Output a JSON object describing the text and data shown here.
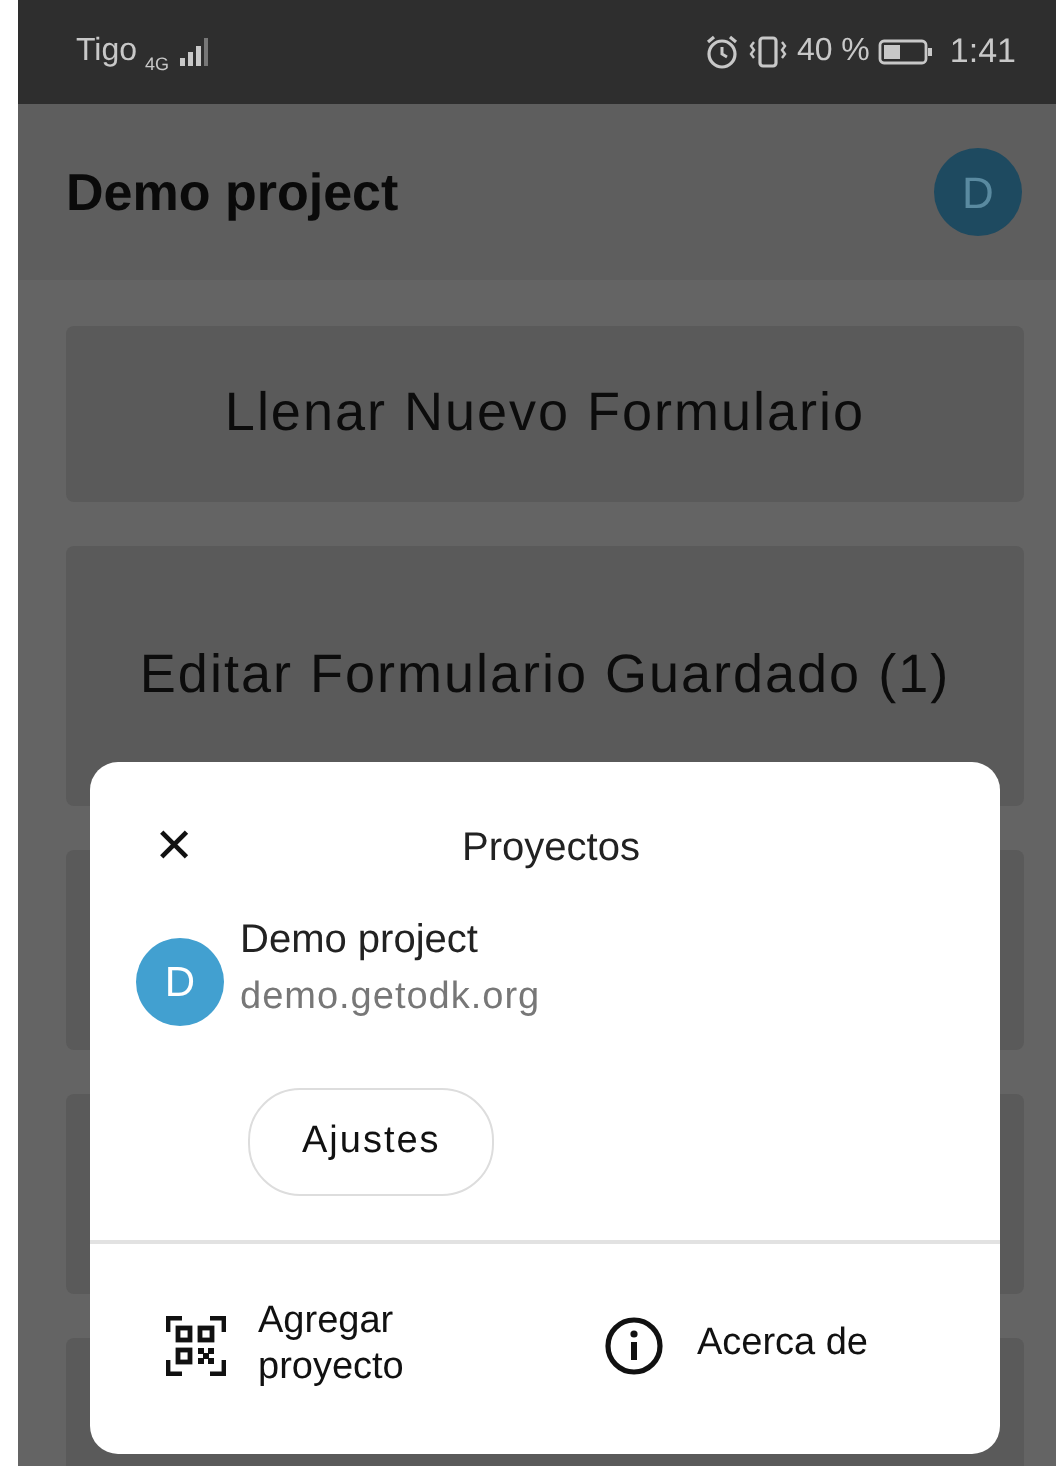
{
  "status_bar": {
    "carrier": "Tigo",
    "network": "4G",
    "battery": {
      "reading": "40 %",
      "level": 0.4
    },
    "time": "1:41"
  },
  "app_bar": {
    "title": "Demo project",
    "avatar_letter": "D"
  },
  "menu_buttons": [
    "Llenar Nuevo Formulario",
    "Editar Formulario Guardado (1)"
  ],
  "dialog": {
    "title": "Proyectos",
    "close": "✕",
    "project": {
      "avatar_letter": "D",
      "name": "Demo project",
      "url": "demo.getodk.org"
    },
    "settings_button": "Ajustes",
    "actions": [
      {
        "kind": "qr",
        "label": "Agregar proyecto"
      },
      {
        "kind": "info",
        "label": "Acerca de"
      }
    ]
  }
}
